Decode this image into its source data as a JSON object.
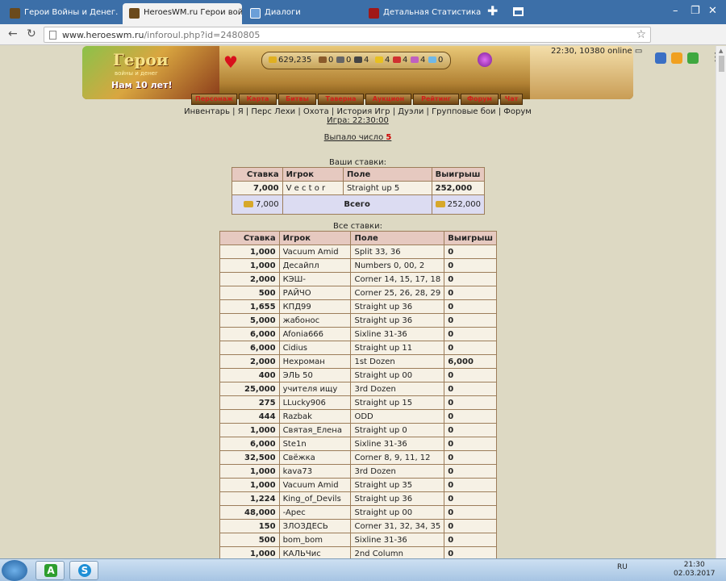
{
  "browser": {
    "tabs": [
      {
        "title": "Герои Войны и Денег. Онлайн",
        "icon": "hwm-icon"
      },
      {
        "title": "HeroesWM.ru Герои войны и д",
        "icon": "hwm-icon"
      },
      {
        "title": "Диалоги",
        "icon": "chat-icon"
      },
      {
        "title": "Детальная Статистика Рулетка",
        "icon": "hwm-icon"
      }
    ],
    "url_host": "www.heroeswm.ru",
    "url_path": "/inforoul.php?id=2480805",
    "colors": {
      "tab_bar": "#3c6fa8",
      "link_underline": "#222222",
      "win_number": "#cc0000"
    }
  },
  "header": {
    "logo_title": "Герои",
    "logo_subtitle": "войны и денег",
    "logo_slogan": "Нам 10 лет!",
    "resources": {
      "gold": "629,235",
      "wood": "0",
      "ore": "0",
      "mercury": "4",
      "sulfur": "4",
      "crystal": "4",
      "gems": "4",
      "diamonds": "0"
    },
    "online": "22:30, 10380 online",
    "menu": [
      "Персонаж",
      "Карта",
      "Битвы",
      "Таверна",
      "Аукцион",
      "Рейтинг",
      "Форум",
      "Чат"
    ]
  },
  "sublinks": "Инвентарь | Я | Перс Лехи | Охота | История Игр | Дуэли | Групповые бои | Форум",
  "game_time": "Игра: 22:30:00",
  "result_label": "Выпало число",
  "result_number": "5",
  "your_bets": {
    "caption": "Ваши ставки:",
    "headers": [
      "Ставка",
      "Игрок",
      "Поле",
      "Выигрыш"
    ],
    "rows": [
      {
        "bet": "7,000",
        "player": "V e c t o r",
        "field": "Straight up 5",
        "win": "252,000"
      }
    ],
    "total": {
      "bet": "7,000",
      "label": "Всего",
      "win": "252,000"
    }
  },
  "all_bets": {
    "caption": "Все ставки:",
    "headers": [
      "Ставка",
      "Игрок",
      "Поле",
      "Выигрыш"
    ],
    "rows": [
      {
        "bet": "1,000",
        "player": "Vacuum Amid",
        "field": "Split 33, 36",
        "win": "0"
      },
      {
        "bet": "1,000",
        "player": "Десайпл",
        "field": "Numbers 0, 00, 2",
        "win": "0"
      },
      {
        "bet": "2,000",
        "player": "КЭШ-",
        "field": "Corner 14, 15, 17, 18",
        "win": "0"
      },
      {
        "bet": "500",
        "player": "РАЙЧО",
        "field": "Corner 25, 26, 28, 29",
        "win": "0"
      },
      {
        "bet": "1,655",
        "player": "КПД99",
        "field": "Straight up 36",
        "win": "0"
      },
      {
        "bet": "5,000",
        "player": "жабонос",
        "field": "Straight up 36",
        "win": "0"
      },
      {
        "bet": "6,000",
        "player": "Afonia666",
        "field": "Sixline 31-36",
        "win": "0"
      },
      {
        "bet": "6,000",
        "player": "Cidius",
        "field": "Straight up 11",
        "win": "0"
      },
      {
        "bet": "2,000",
        "player": "Нехроман",
        "field": "1st Dozen",
        "win": "6,000"
      },
      {
        "bet": "400",
        "player": "ЭЛЬ 50",
        "field": "Straight up 00",
        "win": "0"
      },
      {
        "bet": "25,000",
        "player": "учителя ищу",
        "field": "3rd Dozen",
        "win": "0"
      },
      {
        "bet": "275",
        "player": "LLucky906",
        "field": "Straight up 15",
        "win": "0"
      },
      {
        "bet": "444",
        "player": "Razbak",
        "field": "ODD",
        "win": "0"
      },
      {
        "bet": "1,000",
        "player": "Святая_Елена",
        "field": "Straight up 0",
        "win": "0"
      },
      {
        "bet": "6,000",
        "player": "Ste1n",
        "field": "Sixline 31-36",
        "win": "0"
      },
      {
        "bet": "32,500",
        "player": "Свёжка",
        "field": "Corner 8, 9, 11, 12",
        "win": "0"
      },
      {
        "bet": "1,000",
        "player": "kava73",
        "field": "3rd Dozen",
        "win": "0"
      },
      {
        "bet": "1,000",
        "player": "Vacuum Amid",
        "field": "Straight up 35",
        "win": "0"
      },
      {
        "bet": "1,224",
        "player": "King_of_Devils",
        "field": "Straight up 36",
        "win": "0"
      },
      {
        "bet": "48,000",
        "player": "-Apec",
        "field": "Straight up 00",
        "win": "0"
      },
      {
        "bet": "150",
        "player": "ЗЛОЗДЕСЬ",
        "field": "Corner 31, 32, 34, 35",
        "win": "0"
      },
      {
        "bet": "500",
        "player": "bom_bom",
        "field": "Sixline 31-36",
        "win": "0"
      },
      {
        "bet": "1,000",
        "player": "КАЛЬЧис",
        "field": "2nd Column",
        "win": "0"
      }
    ]
  },
  "taskbar": {
    "apps": [
      {
        "icon": "android-icon",
        "letter": "A",
        "color": "#2e9e2e"
      },
      {
        "icon": "skype-icon",
        "letter": "S",
        "color": "#1e8fd6"
      }
    ],
    "lang": "RU",
    "time": "21:30",
    "date": "02.03.2017"
  }
}
